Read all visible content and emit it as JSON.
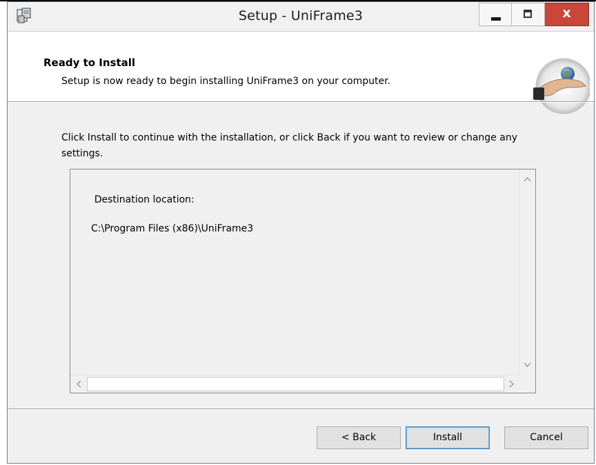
{
  "window": {
    "title": "Setup - UniFrame3",
    "controls": {
      "minimize": "minimize",
      "maximize": "maximize",
      "close": "x"
    }
  },
  "header": {
    "title": "Ready to Install",
    "subtitle": "Setup is now ready to begin installing UniFrame3 on your computer.",
    "image": "hand-holding-globe-icon"
  },
  "body": {
    "instructions": "Click Install to continue with the installation, or click Back if you want to review or change any settings.",
    "memo": {
      "label": "Destination location:",
      "value": "C:\\Program Files (x86)\\UniFrame3"
    }
  },
  "buttons": {
    "back": "< Back",
    "install": "Install",
    "cancel": "Cancel"
  },
  "scroll": {
    "up": "^",
    "down": "v",
    "left": "<",
    "right": ">"
  },
  "colors": {
    "close_button": "#c8473a",
    "default_button_border": "#3c7fb1",
    "background": "#f0f0f0"
  }
}
